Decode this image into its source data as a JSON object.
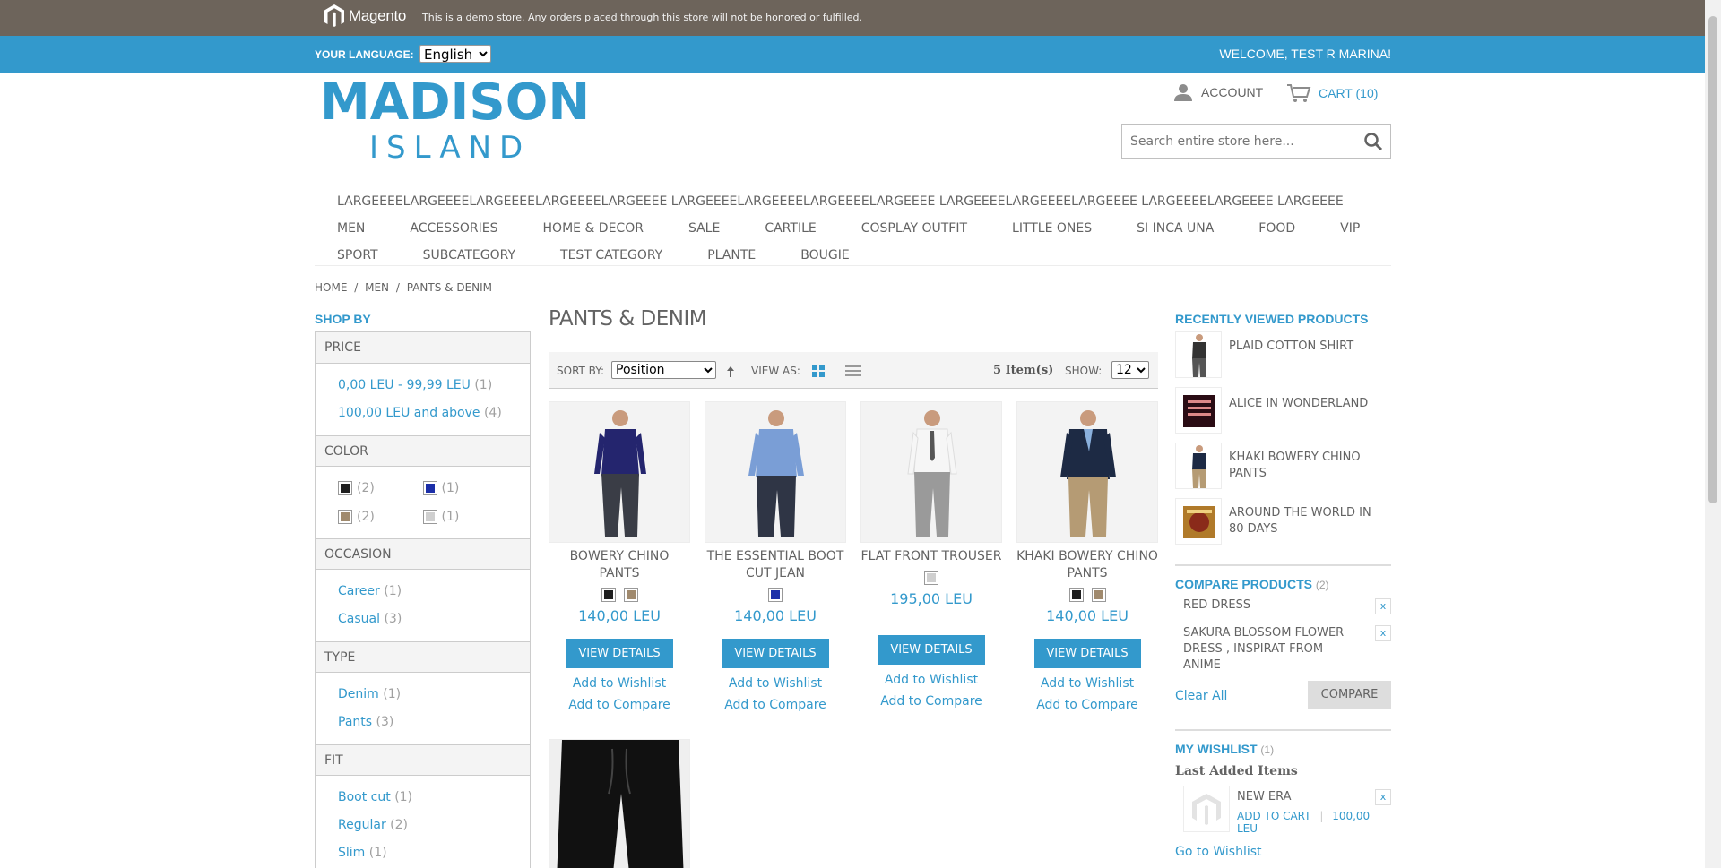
{
  "demo": {
    "brand": "Magento",
    "notice": "This is a demo store. Any orders placed through this store will not be honored or fulfilled."
  },
  "header": {
    "language_label": "YOUR LANGUAGE:",
    "language_value": "English",
    "welcome": "WELCOME, TEST R MARINA!",
    "logo_line1": "MADISON",
    "logo_line2": "ISLAND",
    "account": "ACCOUNT",
    "cart": "CART (10)",
    "search_placeholder": "Search entire store here..."
  },
  "nav": {
    "row1": "LARGEEEELARGEEEELARGEEEELARGEEEELARGEEEE LARGEEEELARGEEEELARGEEEELARGEEEE LARGEEEELARGEEEELARGEEEE LARGEEEELARGEEEE LARGEEEE",
    "row2": [
      "MEN",
      "ACCESSORIES",
      "HOME & DECOR",
      "SALE",
      "CARTILE",
      "COSPLAY OUTFIT",
      "LITTLE ONES",
      "SI INCA UNA",
      "FOOD",
      "VIP"
    ],
    "row3": [
      "SPORT",
      "SUBCATEGORY",
      "TEST CATEGORY",
      "PLANTE",
      "BOUGIE"
    ]
  },
  "breadcrumb": [
    "HOME",
    "/",
    "MEN",
    "/",
    "PANTS & DENIM"
  ],
  "filters": {
    "title": "SHOP BY",
    "price_head": "PRICE",
    "price": [
      {
        "label": "0,00 LEU - 99,99 LEU",
        "count": "(1)"
      },
      {
        "label": "100,00 LEU and above",
        "count": "(4)"
      }
    ],
    "color_head": "COLOR",
    "colors": [
      {
        "color": "#1f1f1f",
        "count": "(2)"
      },
      {
        "color": "#1c2fa8",
        "count": "(1)"
      },
      {
        "color": "#a08a6e",
        "count": "(2)"
      },
      {
        "color": "#cfcfcf",
        "count": "(1)"
      }
    ],
    "occasion_head": "OCCASION",
    "occasion": [
      {
        "label": "Career",
        "count": "(1)"
      },
      {
        "label": "Casual",
        "count": "(3)"
      }
    ],
    "type_head": "TYPE",
    "type": [
      {
        "label": "Denim",
        "count": "(1)"
      },
      {
        "label": "Pants",
        "count": "(3)"
      }
    ],
    "fit_head": "FIT",
    "fit": [
      {
        "label": "Boot cut",
        "count": "(1)"
      },
      {
        "label": "Regular",
        "count": "(2)"
      },
      {
        "label": "Slim",
        "count": "(1)"
      }
    ]
  },
  "main": {
    "title": "PANTS & DENIM",
    "sort_label": "SORT BY:",
    "sort_value": "Position",
    "view_label": "VIEW AS:",
    "count": "5 Item(s)",
    "show_label": "SHOW:",
    "show_value": "12"
  },
  "products": [
    {
      "name": "BOWERY CHINO PANTS",
      "price": "140,00 LEU",
      "swatches": [
        "#1f1f1f",
        "#a08a6e"
      ],
      "view": "VIEW DETAILS",
      "wish": "Add to Wishlist",
      "compare": "Add to Compare"
    },
    {
      "name": "THE ESSENTIAL BOOT CUT JEAN",
      "price": "140,00 LEU",
      "swatches": [
        "#1c2fa8"
      ],
      "view": "VIEW DETAILS",
      "wish": "Add to Wishlist",
      "compare": "Add to Compare"
    },
    {
      "name": "FLAT FRONT TROUSER",
      "price": "195,00 LEU",
      "swatches": [
        "#cfcfcf"
      ],
      "view": "VIEW DETAILS",
      "wish": "Add to Wishlist",
      "compare": "Add to Compare"
    },
    {
      "name": "KHAKI BOWERY CHINO PANTS",
      "price": "140,00 LEU",
      "swatches": [
        "#1f1f1f",
        "#a08a6e"
      ],
      "view": "VIEW DETAILS",
      "wish": "Add to Wishlist",
      "compare": "Add to Compare"
    }
  ],
  "recent": {
    "title": "RECENTLY VIEWED PRODUCTS",
    "items": [
      "PLAID COTTON SHIRT",
      "ALICE IN WONDERLAND",
      "KHAKI BOWERY CHINO PANTS",
      "AROUND THE WORLD IN 80 DAYS"
    ]
  },
  "compare": {
    "title": "COMPARE PRODUCTS",
    "count": "(2)",
    "items": [
      "RED DRESS",
      "SAKURA BLOSSOM FLOWER DRESS , INSPIRAT FROM ANIME"
    ],
    "remove": "x",
    "clear": "Clear All",
    "button": "COMPARE"
  },
  "wishlist": {
    "title": "MY WISHLIST",
    "count": "(1)",
    "subtitle": "Last Added Items",
    "item": "NEW ERA",
    "add": "ADD TO CART",
    "price": "100,00 LEU",
    "remove": "x",
    "go": "Go to Wishlist"
  }
}
